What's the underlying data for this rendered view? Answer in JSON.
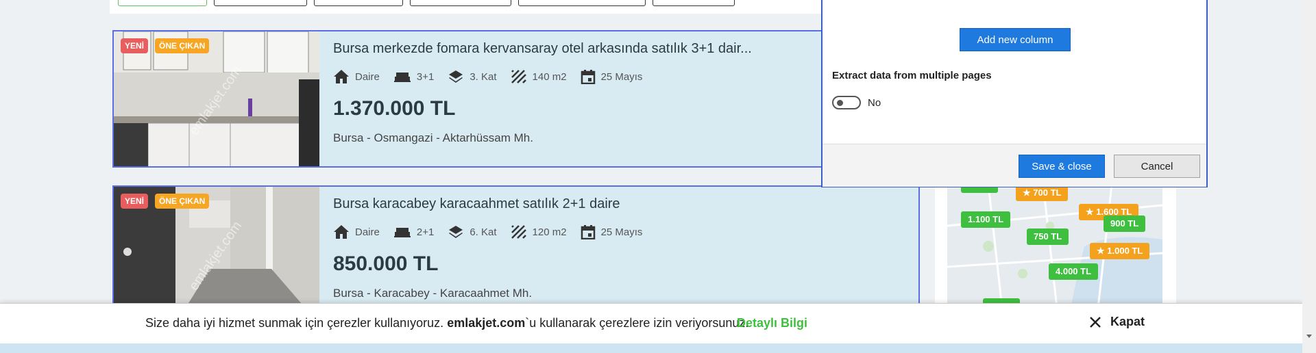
{
  "listings": [
    {
      "badge_new": "YENİ",
      "badge_featured": "ÖNE ÇIKAN",
      "watermark": "emlakjet.com",
      "title": "Bursa merkezde fomara kervansaray otel arkasında satılık 3+1 dair...",
      "type": "Daire",
      "rooms": "3+1",
      "floor": "3. Kat",
      "area": "140 m2",
      "date": "25 Mayıs",
      "price": "1.370.000 TL",
      "location": "Bursa - Osmangazi - Aktarhüssam Mh."
    },
    {
      "badge_new": "YENİ",
      "badge_featured": "ÖNE ÇIKAN",
      "watermark": "emlakjet.com",
      "title": "Bursa karacabey karacaahmet satılık 2+1 daire",
      "type": "Daire",
      "rooms": "2+1",
      "floor": "6. Kat",
      "area": "120 m2",
      "date": "25 Mayıs",
      "price": "850.000 TL",
      "location": "Bursa - Karacabey - Karacaahmet Mh."
    }
  ],
  "map_pins": [
    {
      "label": "700 TL",
      "featured": true
    },
    {
      "label": "1.600 TL",
      "featured": true
    },
    {
      "label": "1.100 TL",
      "featured": false
    },
    {
      "label": "900 TL",
      "featured": false
    },
    {
      "label": "750 TL",
      "featured": false
    },
    {
      "label": "1.000 TL",
      "featured": true
    },
    {
      "label": "4.000 TL",
      "featured": false
    }
  ],
  "dialog": {
    "add_column_label": "Add new column",
    "extract_heading": "Extract data from multiple pages",
    "toggle_label": "No",
    "save_label": "Save & close",
    "cancel_label": "Cancel"
  },
  "cookie": {
    "text_before": "Size daha iyi hizmet sunmak için çerezler kullanıyoruz. ",
    "brand": "emlakjet.com",
    "text_after": "`u kullanarak çerezlere izin veriyorsunuz.",
    "detail_link": "Detaylı Bilgi",
    "close_label": "Kapat"
  },
  "colors": {
    "accent_green": "#3fbf3f",
    "accent_orange": "#f4a21e",
    "badge_red": "#e85d5d",
    "primary_blue": "#1f7ae0"
  }
}
